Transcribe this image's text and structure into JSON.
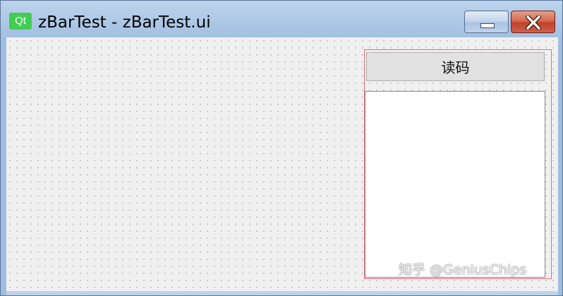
{
  "window": {
    "title": "zBarTest - zBarTest.ui",
    "logo_text": "Qt",
    "logo_color": "#41cd52",
    "minimize_icon": "minimize-icon",
    "close_icon": "close-icon"
  },
  "form": {
    "read_button_label": "读码",
    "output_text": ""
  },
  "watermark": "知乎 @GeniusChips"
}
